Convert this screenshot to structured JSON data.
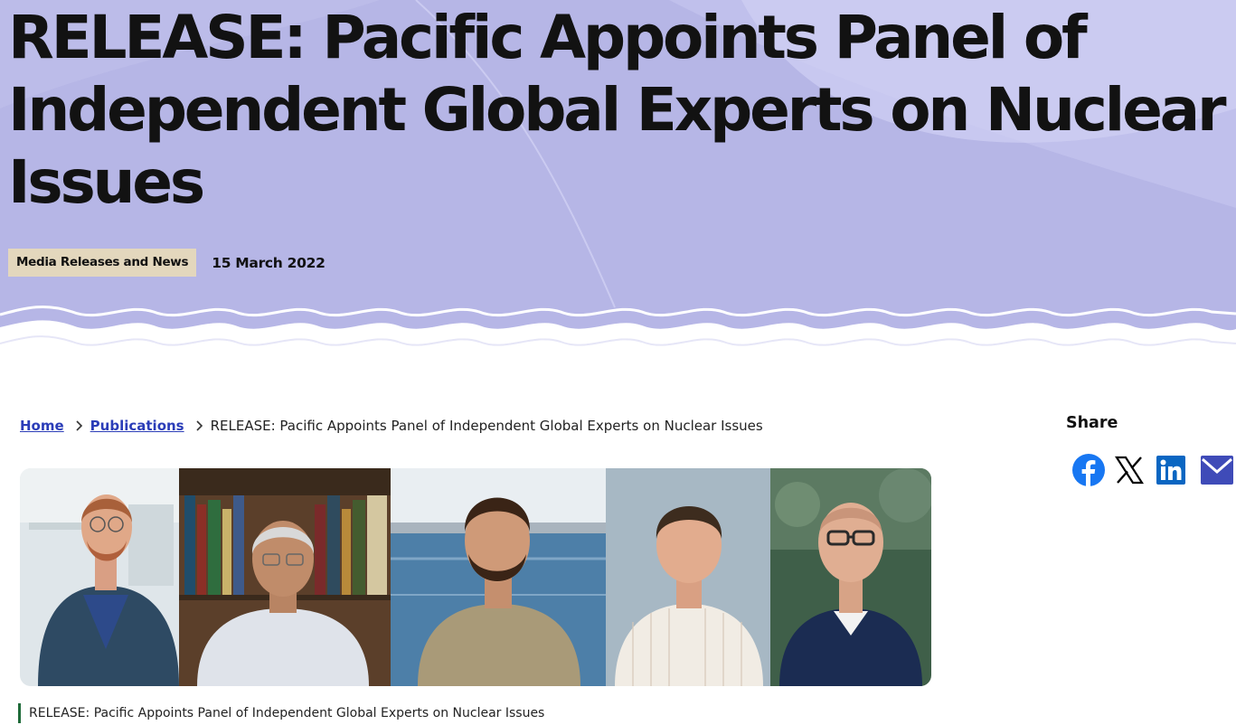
{
  "hero": {
    "title": "RELEASE: Pacific Appoints Panel of Independent Global Experts on Nuclear Issues",
    "category": "Media Releases and News",
    "date": "15 March 2022",
    "colors": {
      "background": "#b4b4e6",
      "wave_line": "#ffffff"
    }
  },
  "breadcrumb": {
    "home": "Home",
    "publications": "Publications",
    "current": "RELEASE: Pacific Appoints Panel of Independent Global Experts on Nuclear Issues",
    "link_color": "#2b3db8"
  },
  "image": {
    "caption": "RELEASE: Pacific Appoints Panel of Independent Global Experts on Nuclear Issues",
    "portrait_count": 5
  },
  "share": {
    "title": "Share",
    "icons": [
      "facebook-icon",
      "x-icon",
      "linkedin-icon",
      "email-icon"
    ],
    "colors": {
      "facebook": "#1877f2",
      "x": "#000000",
      "linkedin": "#0a66c2",
      "email": "#3f4bb8"
    }
  }
}
